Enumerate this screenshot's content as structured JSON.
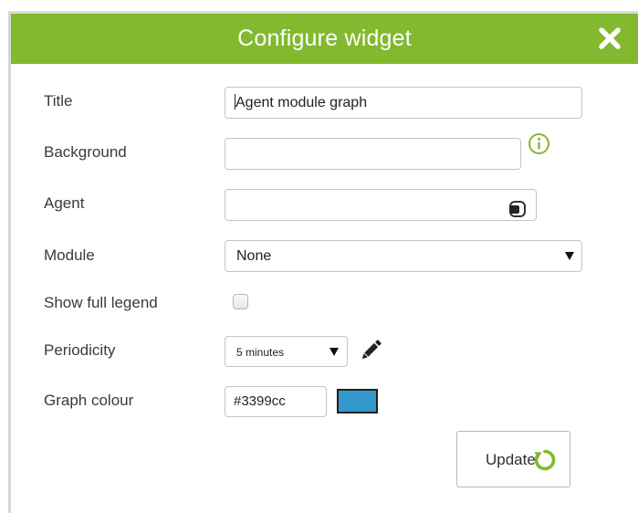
{
  "dialog": {
    "title": "Configure widget",
    "close_icon": "close-icon",
    "accent_color": "#82b92e"
  },
  "form": {
    "title": {
      "label": "Title",
      "value": "Agent module graph"
    },
    "background": {
      "label": "Background",
      "value": "",
      "help_icon": "info-icon"
    },
    "agent": {
      "label": "Agent",
      "value": "",
      "icon": "agent-selector-icon"
    },
    "module": {
      "label": "Module",
      "selected": "None"
    },
    "show_full_legend": {
      "label": "Show full legend",
      "checked": false
    },
    "periodicity": {
      "label": "Periodicity",
      "selected": "5 minutes",
      "edit_icon": "pencil-icon"
    },
    "graph_colour": {
      "label": "Graph colour",
      "value": "#3399cc",
      "swatch_color": "#3399cc"
    }
  },
  "actions": {
    "update_label": "Update",
    "update_icon": "refresh-icon"
  }
}
